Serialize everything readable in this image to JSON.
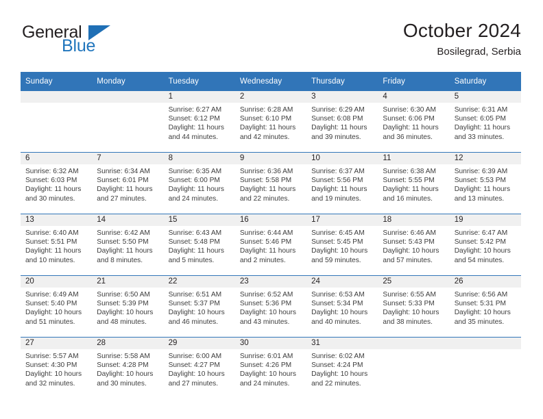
{
  "brand": {
    "name_top": "General",
    "name_bottom": "Blue",
    "triangle_icon": "brand-triangle-icon",
    "colors": {
      "text": "#231f20",
      "blue": "#2176bd",
      "triangle": "#1f6fb5"
    }
  },
  "header": {
    "month_title": "October 2024",
    "location": "Bosilegrad, Serbia"
  },
  "theme": {
    "header_blue": "#3175b8",
    "daynum_band": "#f0f0f0",
    "row_rule": "#3175b8",
    "body_text": "#3c3c3c"
  },
  "calendar": {
    "weekday_headers": [
      "Sunday",
      "Monday",
      "Tuesday",
      "Wednesday",
      "Thursday",
      "Friday",
      "Saturday"
    ],
    "labels": {
      "sunrise": "Sunrise:",
      "sunset": "Sunset:",
      "daylight": "Daylight:"
    },
    "weeks": [
      [
        {
          "day": "",
          "empty": true
        },
        {
          "day": "",
          "empty": true
        },
        {
          "day": "1",
          "sunrise": "Sunrise: 6:27 AM",
          "sunset": "Sunset: 6:12 PM",
          "daylight_line1": "Daylight: 11 hours",
          "daylight_line2": "and 44 minutes."
        },
        {
          "day": "2",
          "sunrise": "Sunrise: 6:28 AM",
          "sunset": "Sunset: 6:10 PM",
          "daylight_line1": "Daylight: 11 hours",
          "daylight_line2": "and 42 minutes."
        },
        {
          "day": "3",
          "sunrise": "Sunrise: 6:29 AM",
          "sunset": "Sunset: 6:08 PM",
          "daylight_line1": "Daylight: 11 hours",
          "daylight_line2": "and 39 minutes."
        },
        {
          "day": "4",
          "sunrise": "Sunrise: 6:30 AM",
          "sunset": "Sunset: 6:06 PM",
          "daylight_line1": "Daylight: 11 hours",
          "daylight_line2": "and 36 minutes."
        },
        {
          "day": "5",
          "sunrise": "Sunrise: 6:31 AM",
          "sunset": "Sunset: 6:05 PM",
          "daylight_line1": "Daylight: 11 hours",
          "daylight_line2": "and 33 minutes."
        }
      ],
      [
        {
          "day": "6",
          "sunrise": "Sunrise: 6:32 AM",
          "sunset": "Sunset: 6:03 PM",
          "daylight_line1": "Daylight: 11 hours",
          "daylight_line2": "and 30 minutes."
        },
        {
          "day": "7",
          "sunrise": "Sunrise: 6:34 AM",
          "sunset": "Sunset: 6:01 PM",
          "daylight_line1": "Daylight: 11 hours",
          "daylight_line2": "and 27 minutes."
        },
        {
          "day": "8",
          "sunrise": "Sunrise: 6:35 AM",
          "sunset": "Sunset: 6:00 PM",
          "daylight_line1": "Daylight: 11 hours",
          "daylight_line2": "and 24 minutes."
        },
        {
          "day": "9",
          "sunrise": "Sunrise: 6:36 AM",
          "sunset": "Sunset: 5:58 PM",
          "daylight_line1": "Daylight: 11 hours",
          "daylight_line2": "and 22 minutes."
        },
        {
          "day": "10",
          "sunrise": "Sunrise: 6:37 AM",
          "sunset": "Sunset: 5:56 PM",
          "daylight_line1": "Daylight: 11 hours",
          "daylight_line2": "and 19 minutes."
        },
        {
          "day": "11",
          "sunrise": "Sunrise: 6:38 AM",
          "sunset": "Sunset: 5:55 PM",
          "daylight_line1": "Daylight: 11 hours",
          "daylight_line2": "and 16 minutes."
        },
        {
          "day": "12",
          "sunrise": "Sunrise: 6:39 AM",
          "sunset": "Sunset: 5:53 PM",
          "daylight_line1": "Daylight: 11 hours",
          "daylight_line2": "and 13 minutes."
        }
      ],
      [
        {
          "day": "13",
          "sunrise": "Sunrise: 6:40 AM",
          "sunset": "Sunset: 5:51 PM",
          "daylight_line1": "Daylight: 11 hours",
          "daylight_line2": "and 10 minutes."
        },
        {
          "day": "14",
          "sunrise": "Sunrise: 6:42 AM",
          "sunset": "Sunset: 5:50 PM",
          "daylight_line1": "Daylight: 11 hours",
          "daylight_line2": "and 8 minutes."
        },
        {
          "day": "15",
          "sunrise": "Sunrise: 6:43 AM",
          "sunset": "Sunset: 5:48 PM",
          "daylight_line1": "Daylight: 11 hours",
          "daylight_line2": "and 5 minutes."
        },
        {
          "day": "16",
          "sunrise": "Sunrise: 6:44 AM",
          "sunset": "Sunset: 5:46 PM",
          "daylight_line1": "Daylight: 11 hours",
          "daylight_line2": "and 2 minutes."
        },
        {
          "day": "17",
          "sunrise": "Sunrise: 6:45 AM",
          "sunset": "Sunset: 5:45 PM",
          "daylight_line1": "Daylight: 10 hours",
          "daylight_line2": "and 59 minutes."
        },
        {
          "day": "18",
          "sunrise": "Sunrise: 6:46 AM",
          "sunset": "Sunset: 5:43 PM",
          "daylight_line1": "Daylight: 10 hours",
          "daylight_line2": "and 57 minutes."
        },
        {
          "day": "19",
          "sunrise": "Sunrise: 6:47 AM",
          "sunset": "Sunset: 5:42 PM",
          "daylight_line1": "Daylight: 10 hours",
          "daylight_line2": "and 54 minutes."
        }
      ],
      [
        {
          "day": "20",
          "sunrise": "Sunrise: 6:49 AM",
          "sunset": "Sunset: 5:40 PM",
          "daylight_line1": "Daylight: 10 hours",
          "daylight_line2": "and 51 minutes."
        },
        {
          "day": "21",
          "sunrise": "Sunrise: 6:50 AM",
          "sunset": "Sunset: 5:39 PM",
          "daylight_line1": "Daylight: 10 hours",
          "daylight_line2": "and 48 minutes."
        },
        {
          "day": "22",
          "sunrise": "Sunrise: 6:51 AM",
          "sunset": "Sunset: 5:37 PM",
          "daylight_line1": "Daylight: 10 hours",
          "daylight_line2": "and 46 minutes."
        },
        {
          "day": "23",
          "sunrise": "Sunrise: 6:52 AM",
          "sunset": "Sunset: 5:36 PM",
          "daylight_line1": "Daylight: 10 hours",
          "daylight_line2": "and 43 minutes."
        },
        {
          "day": "24",
          "sunrise": "Sunrise: 6:53 AM",
          "sunset": "Sunset: 5:34 PM",
          "daylight_line1": "Daylight: 10 hours",
          "daylight_line2": "and 40 minutes."
        },
        {
          "day": "25",
          "sunrise": "Sunrise: 6:55 AM",
          "sunset": "Sunset: 5:33 PM",
          "daylight_line1": "Daylight: 10 hours",
          "daylight_line2": "and 38 minutes."
        },
        {
          "day": "26",
          "sunrise": "Sunrise: 6:56 AM",
          "sunset": "Sunset: 5:31 PM",
          "daylight_line1": "Daylight: 10 hours",
          "daylight_line2": "and 35 minutes."
        }
      ],
      [
        {
          "day": "27",
          "sunrise": "Sunrise: 5:57 AM",
          "sunset": "Sunset: 4:30 PM",
          "daylight_line1": "Daylight: 10 hours",
          "daylight_line2": "and 32 minutes."
        },
        {
          "day": "28",
          "sunrise": "Sunrise: 5:58 AM",
          "sunset": "Sunset: 4:28 PM",
          "daylight_line1": "Daylight: 10 hours",
          "daylight_line2": "and 30 minutes."
        },
        {
          "day": "29",
          "sunrise": "Sunrise: 6:00 AM",
          "sunset": "Sunset: 4:27 PM",
          "daylight_line1": "Daylight: 10 hours",
          "daylight_line2": "and 27 minutes."
        },
        {
          "day": "30",
          "sunrise": "Sunrise: 6:01 AM",
          "sunset": "Sunset: 4:26 PM",
          "daylight_line1": "Daylight: 10 hours",
          "daylight_line2": "and 24 minutes."
        },
        {
          "day": "31",
          "sunrise": "Sunrise: 6:02 AM",
          "sunset": "Sunset: 4:24 PM",
          "daylight_line1": "Daylight: 10 hours",
          "daylight_line2": "and 22 minutes."
        },
        {
          "day": "",
          "empty": true
        },
        {
          "day": "",
          "empty": true
        }
      ]
    ]
  }
}
